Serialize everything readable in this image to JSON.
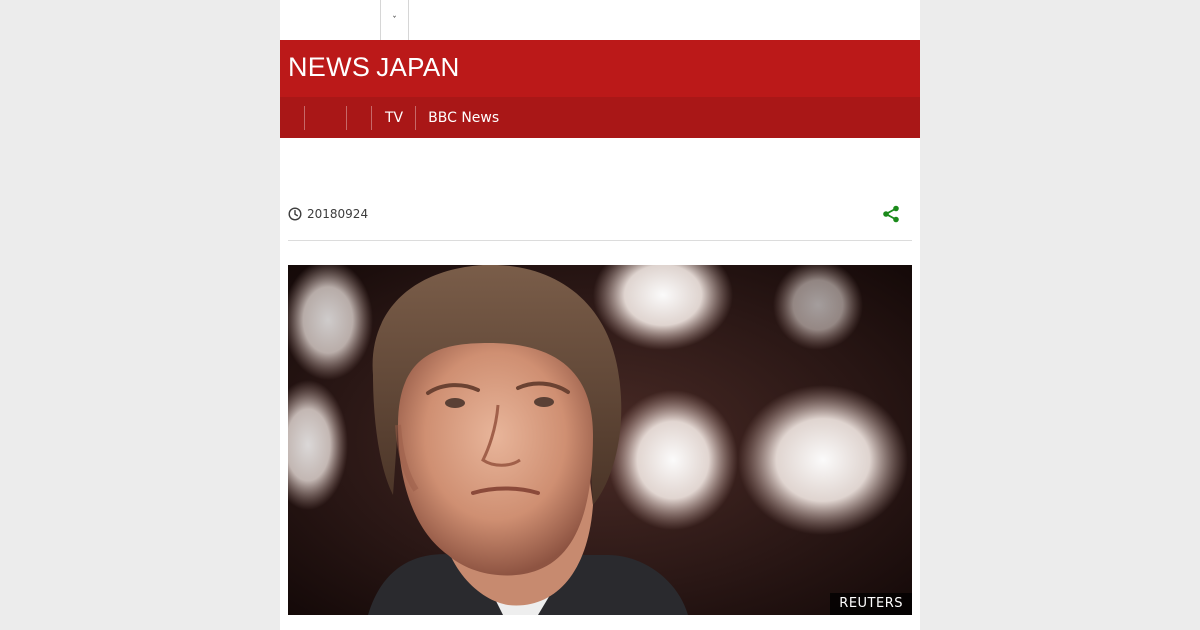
{
  "top_bar": {
    "menu_toggle_glyph": "ˇ"
  },
  "masthead": {
    "logo_primary": "NEWS",
    "logo_secondary": "JAPAN",
    "brand_color": "#bb1919"
  },
  "nav": {
    "items": [
      "TV",
      "BBC News"
    ]
  },
  "article": {
    "date": "20180924"
  },
  "hero": {
    "credit": "REUTERS"
  },
  "colors": {
    "share_accent": "#1a8a1a",
    "nav_bg": "#a91717",
    "page_bg": "#ececec"
  }
}
